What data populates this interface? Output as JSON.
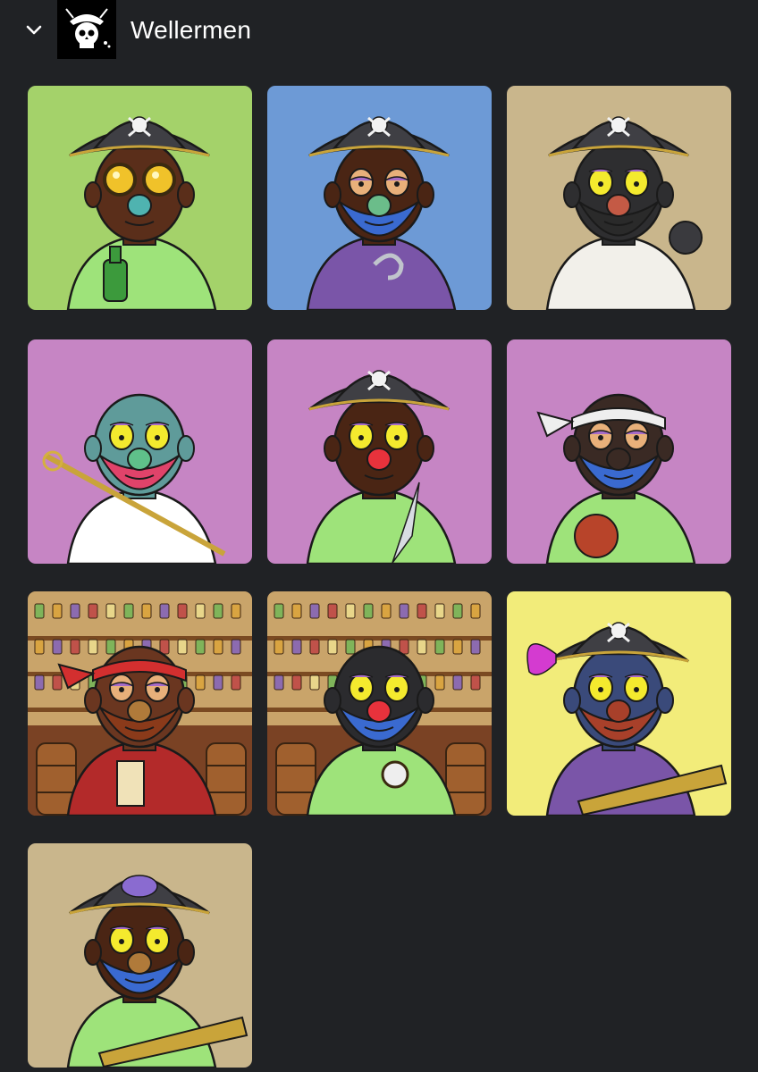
{
  "collection": {
    "name": "Wellermen",
    "expanded": true,
    "icon": "chevron-down-icon",
    "logo_icon": "pirate-skull-logo"
  },
  "colors": {
    "page_bg": "#202225",
    "title_text": "#ffffff"
  },
  "nfts": [
    {
      "bg": "#a4d26a",
      "scene": "plain",
      "skin": "#5a2e1a",
      "hat": "pirate",
      "shirt": "#9ee37a",
      "beard": null,
      "nose": "#4fb3b0",
      "eyes": "goggles",
      "prop": "bottle"
    },
    {
      "bg": "#6d9ad6",
      "scene": "plain",
      "skin": "#4a2514",
      "hat": "pirate",
      "shirt": "#7a55a8",
      "beard": "#3a6ad0",
      "nose": "#6bbd8a",
      "eyes": "sleepy",
      "prop": "hook"
    },
    {
      "bg": "#c9b68c",
      "scene": "plain",
      "skin": "#2e2e30",
      "hat": "pirate",
      "shirt": "#f2f0ea",
      "beard": "#2a2a2a",
      "nose": "#c45a45",
      "eyes": "yellow",
      "prop": "cannonball"
    },
    {
      "bg": "#c685c4",
      "scene": "plain",
      "skin": "#5f9b9a",
      "hat": "none",
      "shirt": "#ffffff",
      "beard": "#e0436a",
      "nose": "#5fc08a",
      "eyes": "yellow",
      "prop": "sword"
    },
    {
      "bg": "#c685c4",
      "scene": "plain",
      "skin": "#4a2514",
      "hat": "pirate",
      "shirt": "#9ee37a",
      "beard": null,
      "nose": "#e8323c",
      "eyes": "yellow",
      "prop": "knife"
    },
    {
      "bg": "#c685c4",
      "scene": "plain",
      "skin": "#3a2a24",
      "hat": "bandana-white",
      "shirt": "#9ee37a",
      "beard": "#3a6ad0",
      "nose": "#3a2a24",
      "eyes": "sleepy",
      "prop": "flask"
    },
    {
      "bg": "#8a5a34",
      "scene": "tavern",
      "skin": "#6a3620",
      "hat": "bandana-red",
      "shirt": "#b32a2a",
      "beard": "#8a3a1a",
      "nose": "#b07a3a",
      "eyes": "sleepy",
      "prop": "scroll"
    },
    {
      "bg": "#8a5a34",
      "scene": "tavern",
      "skin": "#2b2b2e",
      "hat": "none",
      "shirt": "#9ee37a",
      "beard": "#3a6ad0",
      "nose": "#e8323c",
      "eyes": "yellow",
      "prop": "compass"
    },
    {
      "bg": "#f2ec7a",
      "scene": "plain",
      "skin": "#3a4a7a",
      "hat": "pirate-feather",
      "shirt": "#7a55a8",
      "beard": "#a8402a",
      "nose": "#a8402a",
      "eyes": "yellow",
      "prop": "telescope"
    },
    {
      "bg": "#c9b68c",
      "scene": "plain",
      "skin": "#4a2514",
      "hat": "pirate-whale",
      "shirt": "#9ee37a",
      "beard": "#3a6ad0",
      "nose": "#b07a3a",
      "eyes": "yellow",
      "prop": "telescope"
    }
  ]
}
